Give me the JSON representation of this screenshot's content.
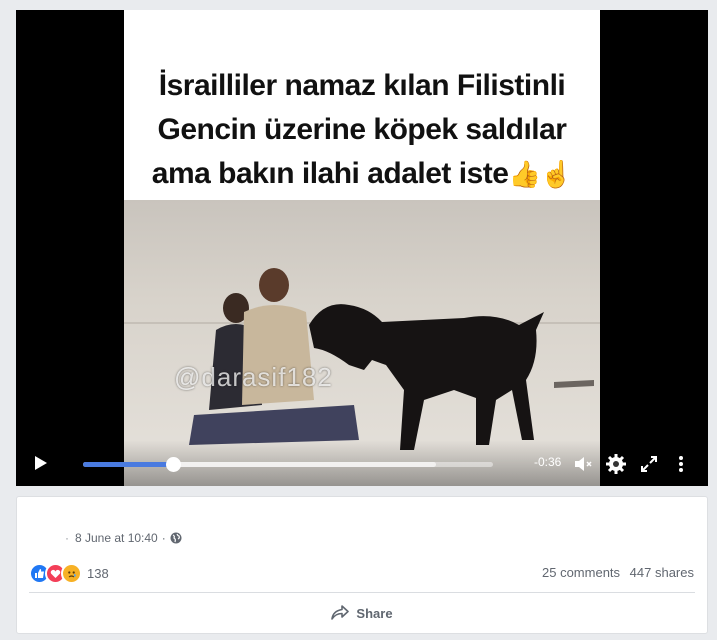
{
  "video": {
    "caption_lines": [
      "İsrailliler namaz kılan Filistinli",
      "Gencin üzerine köpek saldılar",
      "ama bakın ilahi adalet iste"
    ],
    "caption_emoji": "👍☝",
    "watermark": "@darasif182",
    "time_remaining": "-0:36",
    "progress_fraction": 0.22,
    "buffered_fraction": 0.86,
    "accent_color": "#4a7be0",
    "icons": [
      "play-icon",
      "volume-muted-icon",
      "settings-icon",
      "fullscreen-icon",
      "more-options-icon"
    ]
  },
  "post": {
    "meta_separator": "·",
    "timestamp": "8 June at 10:40",
    "meta_dot": "·",
    "privacy_icon": "globe-icon",
    "reaction_icons": [
      "like-icon",
      "love-icon",
      "sad-icon"
    ],
    "reaction_count": "138",
    "comments": "25 comments",
    "shares": "447 shares",
    "share_label": "Share"
  }
}
